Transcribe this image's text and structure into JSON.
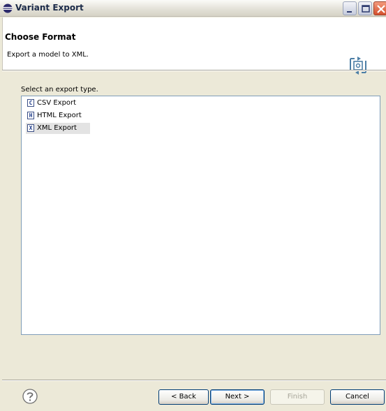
{
  "window": {
    "title": "Variant Export"
  },
  "banner": {
    "title": "Choose Format",
    "description": "Export a model to XML."
  },
  "main": {
    "prompt": "Select an export type.",
    "items": [
      {
        "icon": "csv-file-icon",
        "glyph": "C",
        "label": "CSV Export",
        "selected": false
      },
      {
        "icon": "html-file-icon",
        "glyph": "H",
        "label": "HTML Export",
        "selected": false
      },
      {
        "icon": "xml-file-icon",
        "glyph": "X",
        "label": "XML Export",
        "selected": true
      }
    ]
  },
  "footer": {
    "back_label": "< Back",
    "next_label": "Next >",
    "finish_label": "Finish",
    "cancel_label": "Cancel"
  },
  "colors": {
    "list_border": "#7f9db9",
    "selection": "#e3e3e3",
    "titlebar_close": "#d4502d"
  }
}
